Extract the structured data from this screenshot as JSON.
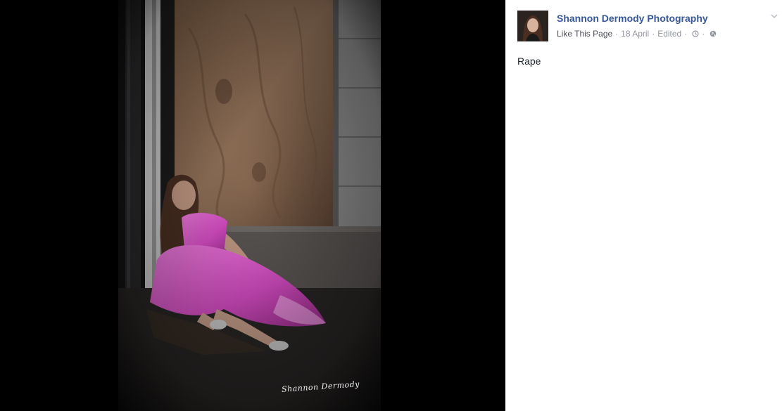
{
  "post": {
    "page_name": "Shannon Dermody Photography",
    "like_link": "Like This Page",
    "separator": "·",
    "date": "18 April",
    "edited": "Edited",
    "caption": "Rape",
    "icons": {
      "avatar": "profile-avatar",
      "history": "edit-history-icon",
      "audience": "globe-icon",
      "menu": "chevron-down-icon"
    }
  },
  "photo": {
    "signature": "Shannon Dermody",
    "colors": {
      "dress": "#e35bd0",
      "plywood": "#8a6a50",
      "siding": "#8c8c8c",
      "stage_bg": "#000000"
    }
  }
}
